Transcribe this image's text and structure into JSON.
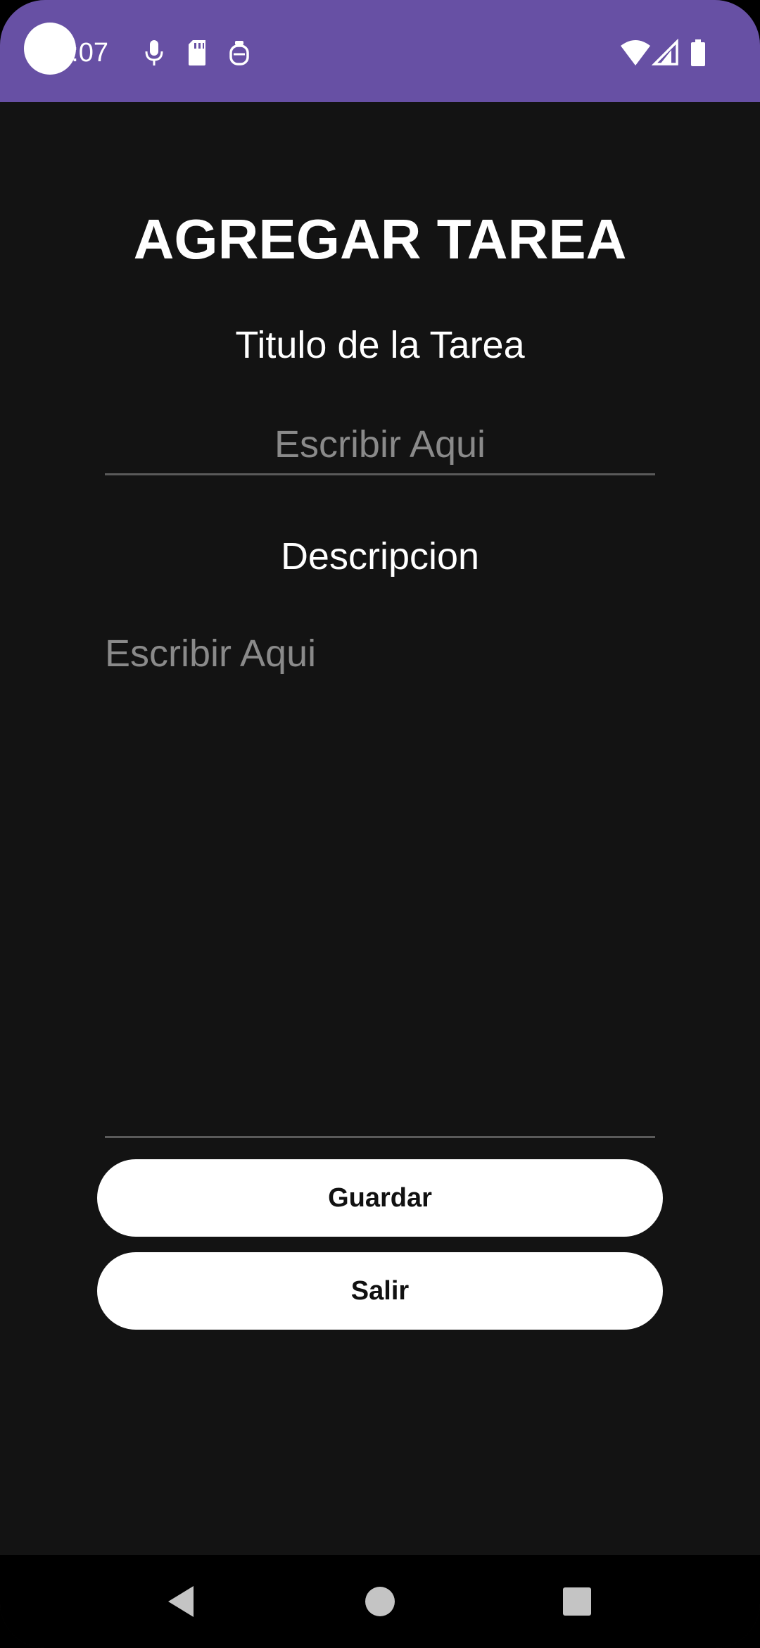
{
  "status_bar": {
    "time": "3:07",
    "color": "#6750A4",
    "icons": [
      "mic-icon",
      "sd-card-icon",
      "assistant-icon",
      "wifi-icon",
      "signal-icon",
      "battery-icon"
    ]
  },
  "page": {
    "title": "AGREGAR TAREA",
    "task_title_label": "Titulo de la Tarea",
    "task_title_placeholder": "Escribir Aqui",
    "description_label": "Descripcion",
    "description_placeholder": "Escribir Aqui"
  },
  "buttons": {
    "save_label": "Guardar",
    "exit_label": "Salir"
  },
  "nav_bar": {
    "icons": [
      "back-icon",
      "home-icon",
      "recents-icon"
    ]
  }
}
